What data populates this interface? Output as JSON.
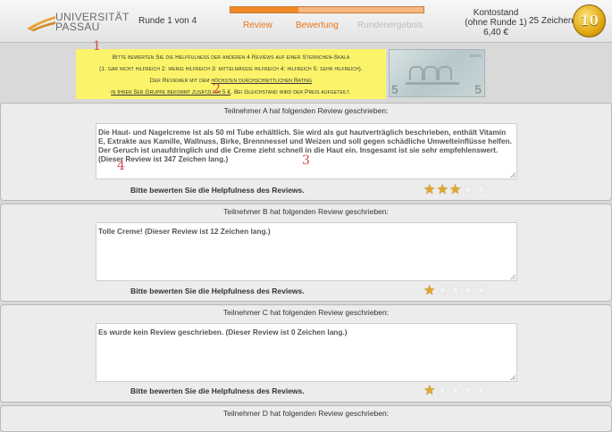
{
  "header": {
    "logo_line1": "UNIVERSITÄT",
    "logo_line2": "PASSAU",
    "round": "Runde 1 von 4",
    "progress": 0.35,
    "tabs": [
      {
        "label": "Review",
        "state": "active"
      },
      {
        "label": "Bewertung",
        "state": "active"
      },
      {
        "label": "Rundenergebnis",
        "state": "inactive"
      }
    ],
    "balance_line1": "Kontostand",
    "balance_line2": "(ohne Runde 1)",
    "balance_line3": "6,40 €",
    "chars_label": "25 Zeichen =",
    "coin_text": "10",
    "accent": "#e8761a"
  },
  "instructions": {
    "line1": "Bitte bewerten Sie die Helpfulness der anderen 4 Reviews auf einer Sternchen-Skala",
    "line2": "(1: gar nicht hilfreich 2: wenig hilfreich 3: mittelmäßig hilfreich 4: hilfreich 5: sehr hilfreich).",
    "line3_pre": "Der Reviewer mit dem ",
    "line3_link": "höchsten durchschnittlichen Rating",
    "line4_link": "in Ihrer 5er Gruppe bekommt zusätzlich 5 €",
    "line4_post": ". Bei Gleichstand wird der Preis aufgeteilt.",
    "annotation_1": "1",
    "annotation_2": "2",
    "background": "#fbf46a"
  },
  "banknote": {
    "value": "5"
  },
  "reviews": [
    {
      "header": "Teilnehmer A hat folgenden Review geschrieben:",
      "text": "Die Haut- und Nagelcreme ist als 50 ml Tube erhältlich. Sie wird als gut hautverträglich beschrieben, enthält Vitamin E, Extrakte aus Kamille, Wallnuss, Birke, Brennnessel und Weizen und soll gegen schädliche Umwelteinflüsse helfen. Der Geruch ist unaufdringlich und die Creme zieht schnell in die Haut ein. Insgesamt ist sie sehr empfehlenswert.",
      "length_note": " (Dieser Review ist 347 Zeichen lang.)",
      "annotation_3": "3",
      "annotation_4": "4",
      "prompt": "Bitte bewerten Sie die Helpfulness des Reviews.",
      "rating": 3
    },
    {
      "header": "Teilnehmer B hat folgenden Review geschrieben:",
      "text": "Tolle Creme!",
      "length_note": " (Dieser Review ist 12 Zeichen lang.)",
      "prompt": "Bitte bewerten Sie die Helpfulness des Reviews.",
      "rating": 1
    },
    {
      "header": "Teilnehmer C hat folgenden Review geschrieben:",
      "text": "Es wurde kein Review geschrieben.",
      "length_note": " (Dieser Review ist 0 Zeichen lang.)",
      "prompt": "Bitte bewerten Sie die Helpfulness des Reviews.",
      "rating": 1
    },
    {
      "header": "Teilnehmer D hat folgenden Review geschrieben:"
    }
  ]
}
